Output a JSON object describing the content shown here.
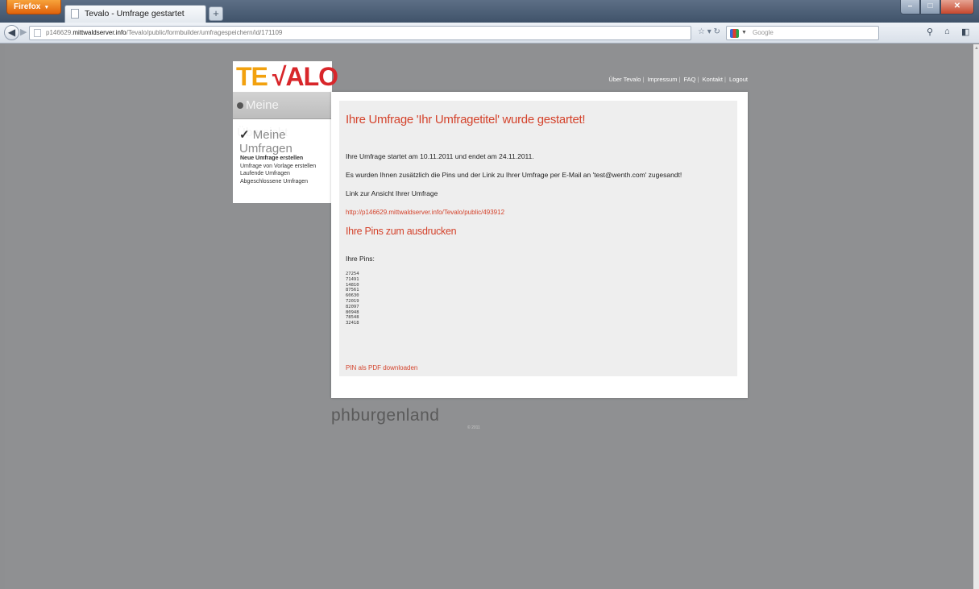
{
  "browser": {
    "menu_button": "Firefox",
    "tab_title": "Tevalo - Umfrage gestartet",
    "new_tab": "+",
    "url_path_prefix": "p146629.",
    "url_host": "mittwaldserver.info",
    "url_path": "/Tevalo/public/formbuilder/umfragespeichern/id/171109",
    "search_placeholder": "Google"
  },
  "logo": {
    "te": "TE",
    "check": "√",
    "alo": "ALO"
  },
  "header_links": [
    "Über Tevalo",
    "Impressum",
    "FAQ",
    "Kontakt",
    "Logout"
  ],
  "sidebar": {
    "overview": "Meine Übersicht",
    "surveys_tick": "✓",
    "surveys": "Meine Umfragen",
    "items": [
      "Neue Umfrage erstellen",
      "Umfrage von Vorlage erstellen",
      "Laufende Umfragen",
      "Abgeschlossene Umfragen"
    ]
  },
  "main": {
    "title": "Ihre Umfrage 'Ihr Umfragetitel' wurde gestartet!",
    "period_text": "Ihre Umfrage startet am 10.11.2011 und endet am 24.11.2011.",
    "mail_text": "Es wurden Ihnen zusätzlich die Pins und der Link zu Ihrer Umfrage per E-Mail an 'test@wenth.com' zugesandt!",
    "link_label": "Link zur Ansicht Ihrer Umfrage",
    "survey_link": "http://p146629.mittwaldserver.info/Tevalo/public/493912",
    "pins_heading": "Ihre Pins zum ausdrucken",
    "pins_label": "Ihre Pins:",
    "pins": [
      "27254",
      "71491",
      "14810",
      "87561",
      "60630",
      "72019",
      "82097",
      "80948",
      "78548",
      "32418"
    ],
    "pdf_link": "PIN als PDF downloaden"
  },
  "footer": {
    "brand": "phburgenland",
    "copyright": "© 2011"
  }
}
